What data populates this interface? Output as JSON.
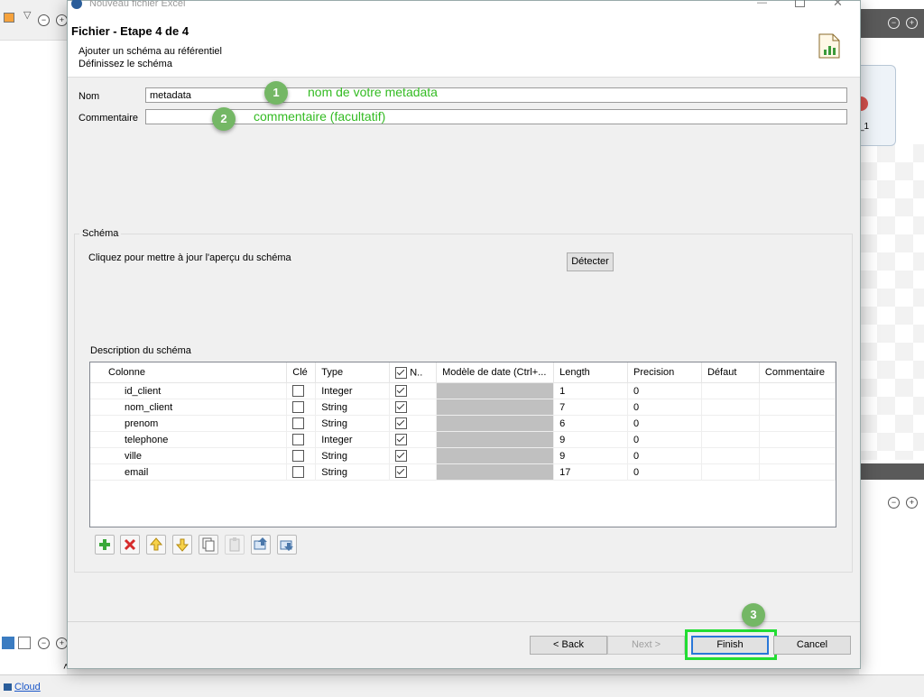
{
  "window": {
    "title": "Nouveau fichier Excel"
  },
  "wizard": {
    "title": "Fichier - Etape 4 de 4",
    "subtitle1": "Ajouter un schéma au référentiel",
    "subtitle2": "Définissez le schéma"
  },
  "form": {
    "nom_label": "Nom",
    "nom_value": "metadata",
    "commentaire_label": "Commentaire",
    "commentaire_value": ""
  },
  "annotations": [
    {
      "number": "1",
      "text": "nom de votre metadata"
    },
    {
      "number": "2",
      "text": "commentaire (facultatif)"
    },
    {
      "number": "3",
      "text": ""
    }
  ],
  "schema": {
    "group_label": "Schéma",
    "refresh_text": "Cliquez pour mettre à jour l'aperçu du schéma",
    "detect_button": "Détecter",
    "description_label": "Description du schéma",
    "columns": [
      "Colonne",
      "Clé",
      "Type",
      "N..",
      "Modèle de date (Ctrl+...",
      "Length",
      "Precision",
      "Défaut",
      "Commentaire"
    ],
    "rows": [
      {
        "colonne": "id_client",
        "cle": false,
        "type": "Integer",
        "nullable": true,
        "length": "1",
        "precision": "0"
      },
      {
        "colonne": "nom_client",
        "cle": false,
        "type": "String",
        "nullable": true,
        "length": "7",
        "precision": "0"
      },
      {
        "colonne": "prenom",
        "cle": false,
        "type": "String",
        "nullable": true,
        "length": "6",
        "precision": "0"
      },
      {
        "colonne": "telephone",
        "cle": false,
        "type": "Integer",
        "nullable": true,
        "length": "9",
        "precision": "0"
      },
      {
        "colonne": "ville",
        "cle": false,
        "type": "String",
        "nullable": true,
        "length": "9",
        "precision": "0"
      },
      {
        "colonne": "email",
        "cle": false,
        "type": "String",
        "nullable": true,
        "length": "17",
        "precision": "0"
      }
    ]
  },
  "toolbar": {
    "icons": [
      "add-icon",
      "delete-icon",
      "move-up-icon",
      "move-down-icon",
      "copy-icon",
      "paste-icon",
      "import-icon",
      "export-icon"
    ]
  },
  "buttons": {
    "back": "< Back",
    "next": "Next >",
    "finish": "Finish",
    "cancel": "Cancel"
  },
  "background": {
    "cloud_link": "Cloud",
    "side_label": "_1"
  },
  "colors": {
    "annotation_green": "#33bb22",
    "badge_green": "#74b765",
    "finish_highlight": "#22dd33"
  }
}
